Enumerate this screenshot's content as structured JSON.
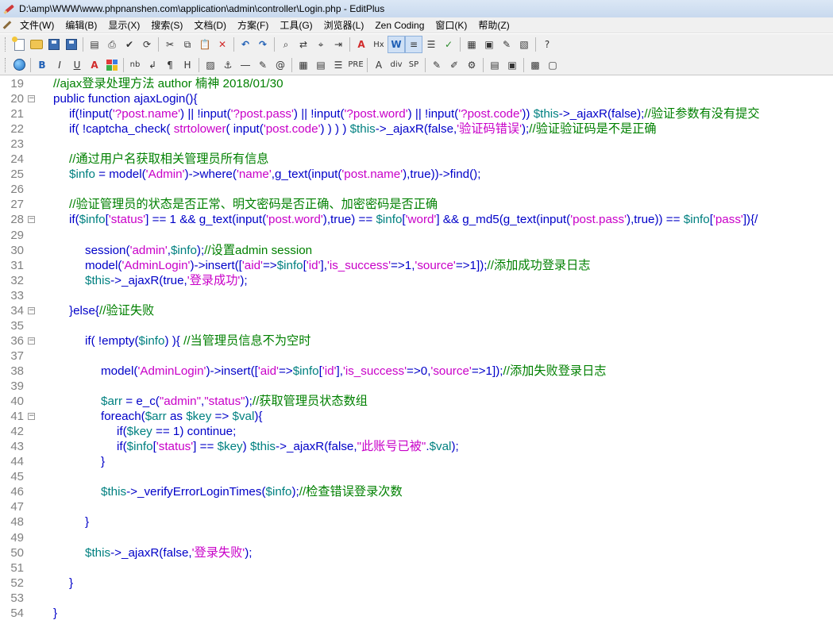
{
  "window": {
    "title": "D:\\amp\\WWW\\www.phpnanshen.com\\application\\admin\\controller\\Login.php - EditPlus"
  },
  "menu": [
    "文件(W)",
    "编辑(B)",
    "显示(X)",
    "搜索(S)",
    "文档(D)",
    "方案(F)",
    "工具(G)",
    "浏览器(L)",
    "Zen Coding",
    "窗口(K)",
    "帮助(Z)"
  ],
  "toolbar1": [
    {
      "name": "new-file-icon",
      "glyph": ""
    },
    {
      "name": "open-folder-icon",
      "glyph": ""
    },
    {
      "name": "save-icon",
      "glyph": ""
    },
    {
      "name": "save-all-icon",
      "glyph": ""
    },
    {
      "name": "print-preview-icon",
      "glyph": "▤"
    },
    {
      "name": "print-icon",
      "glyph": "⎙"
    },
    {
      "name": "spell-check-icon",
      "glyph": "✔"
    },
    {
      "name": "browser-view-icon",
      "glyph": "⟳"
    },
    {
      "name": "cut-icon",
      "glyph": "✂"
    },
    {
      "name": "copy-icon",
      "glyph": "⧉"
    },
    {
      "name": "paste-icon",
      "glyph": "📋"
    },
    {
      "name": "delete-icon",
      "glyph": "✕"
    },
    {
      "name": "undo-icon",
      "glyph": "↶"
    },
    {
      "name": "redo-icon",
      "glyph": "↷"
    },
    {
      "name": "find-icon",
      "glyph": "⌕"
    },
    {
      "name": "replace-icon",
      "glyph": "⇄"
    },
    {
      "name": "find-in-files-icon",
      "glyph": "⌖"
    },
    {
      "name": "go-to-line-icon",
      "glyph": "⇥"
    },
    {
      "name": "font-icon",
      "glyph": "A"
    },
    {
      "name": "hex-icon",
      "glyph": "Hx"
    },
    {
      "name": "word-wrap-icon",
      "glyph": "W"
    },
    {
      "name": "line-number-icon",
      "glyph": "≡"
    },
    {
      "name": "ruler-icon",
      "glyph": "☰"
    },
    {
      "name": "spell-check-toggle-icon",
      "glyph": "✓"
    },
    {
      "name": "output-window-icon",
      "glyph": "▦"
    },
    {
      "name": "clip-text-icon",
      "glyph": "▣"
    },
    {
      "name": "cliptext-edit-icon",
      "glyph": "✎"
    },
    {
      "name": "directory-window-icon",
      "glyph": "▧"
    },
    {
      "name": "help-pointer-icon",
      "glyph": "?"
    }
  ],
  "toolbar2": [
    {
      "name": "browser-icon",
      "glyph": ""
    },
    {
      "name": "bold-icon",
      "glyph": "B"
    },
    {
      "name": "italic-icon",
      "glyph": "I"
    },
    {
      "name": "underline-icon",
      "glyph": "U"
    },
    {
      "name": "font-color-icon",
      "glyph": "A"
    },
    {
      "name": "color-palette-icon",
      "glyph": ""
    },
    {
      "name": "nobr-icon",
      "glyph": "nb"
    },
    {
      "name": "line-break-icon",
      "glyph": "↲"
    },
    {
      "name": "paragraph-icon",
      "glyph": "¶"
    },
    {
      "name": "heading-icon",
      "glyph": "H"
    },
    {
      "name": "image-icon",
      "glyph": "▨"
    },
    {
      "name": "anchor-icon",
      "glyph": "⚓"
    },
    {
      "name": "horizontal-rule-icon",
      "glyph": "―"
    },
    {
      "name": "pencil-icon",
      "glyph": "✎"
    },
    {
      "name": "comment-icon",
      "glyph": "@"
    },
    {
      "name": "table-icon",
      "glyph": "▦"
    },
    {
      "name": "form-icon",
      "glyph": "▤"
    },
    {
      "name": "center-icon",
      "glyph": "☰"
    },
    {
      "name": "pre-icon",
      "glyph": "PRE"
    },
    {
      "name": "char-icon",
      "glyph": "A"
    },
    {
      "name": "div-icon",
      "glyph": "div"
    },
    {
      "name": "span-icon",
      "glyph": "SP"
    },
    {
      "name": "edit-html-icon",
      "glyph": "✎"
    },
    {
      "name": "highlight-icon",
      "glyph": "✐"
    },
    {
      "name": "scripts-icon",
      "glyph": "⚙"
    },
    {
      "name": "html-toolbar-icon",
      "glyph": "▤"
    },
    {
      "name": "html-toolbar2-icon",
      "glyph": "▣"
    },
    {
      "name": "color-picker-icon",
      "glyph": "▩"
    },
    {
      "name": "window-icon",
      "glyph": "▢"
    }
  ],
  "editor": {
    "lines": [
      {
        "n": "19",
        "fold": false,
        "indent": 0,
        "tokens": [
          [
            "cm",
            "//ajax登录处理方法 author 楠神 2018/01/30"
          ]
        ]
      },
      {
        "n": "20",
        "fold": true,
        "indent": 0,
        "tokens": [
          [
            "kw",
            "public function ajaxLogin(){"
          ]
        ]
      },
      {
        "n": "21",
        "fold": false,
        "indent": 1,
        "tokens": [
          [
            "kw",
            "if(!input("
          ],
          [
            "st",
            "'?post.name'"
          ],
          [
            "kw",
            ") || !input("
          ],
          [
            "st",
            "'?post.pass'"
          ],
          [
            "kw",
            ") || !input("
          ],
          [
            "st",
            "'?post.word'"
          ],
          [
            "kw",
            ") || !input("
          ],
          [
            "st",
            "'?post.code'"
          ],
          [
            "kw",
            ")) "
          ],
          [
            "vr",
            "$this"
          ],
          [
            "kw",
            "->_ajaxR(false);"
          ],
          [
            "cm",
            "//验证参数有没有提交"
          ]
        ]
      },
      {
        "n": "22",
        "fold": false,
        "indent": 1,
        "tokens": [
          [
            "kw",
            "if( !captcha_check( "
          ],
          [
            "st",
            "strtolower"
          ],
          [
            "kw",
            "( input("
          ],
          [
            "st",
            "'post.code'"
          ],
          [
            "kw",
            ") ) ) ) "
          ],
          [
            "vr",
            "$this"
          ],
          [
            "kw",
            "->_ajaxR(false,"
          ],
          [
            "st",
            "'验证码错误'"
          ],
          [
            "kw",
            ");"
          ],
          [
            "cm",
            "//验证验证码是不是正确"
          ]
        ]
      },
      {
        "n": "23",
        "fold": false,
        "indent": 0,
        "tokens": []
      },
      {
        "n": "24",
        "fold": false,
        "indent": 1,
        "tokens": [
          [
            "cm",
            "//通过用户名获取相关管理员所有信息"
          ]
        ]
      },
      {
        "n": "25",
        "fold": false,
        "indent": 1,
        "tokens": [
          [
            "vr",
            "$info"
          ],
          [
            "kw",
            " = model("
          ],
          [
            "st",
            "'Admin'"
          ],
          [
            "kw",
            ")->where("
          ],
          [
            "st",
            "'name'"
          ],
          [
            "kw",
            ",g_text(input("
          ],
          [
            "st",
            "'post.name'"
          ],
          [
            "kw",
            "),true))->find();"
          ]
        ]
      },
      {
        "n": "26",
        "fold": false,
        "indent": 0,
        "tokens": []
      },
      {
        "n": "27",
        "fold": false,
        "indent": 1,
        "tokens": [
          [
            "cm",
            "//验证管理员的状态是否正常、明文密码是否正确、加密密码是否正确"
          ]
        ]
      },
      {
        "n": "28",
        "fold": true,
        "indent": 1,
        "tokens": [
          [
            "kw",
            "if("
          ],
          [
            "vr",
            "$info"
          ],
          [
            "kw",
            "["
          ],
          [
            "st",
            "'status'"
          ],
          [
            "kw",
            "] == 1 && g_text(input("
          ],
          [
            "st",
            "'post.word'"
          ],
          [
            "kw",
            "),true) == "
          ],
          [
            "vr",
            "$info"
          ],
          [
            "kw",
            "["
          ],
          [
            "st",
            "'word'"
          ],
          [
            "kw",
            "] && g_md5(g_text(input("
          ],
          [
            "st",
            "'post.pass'"
          ],
          [
            "kw",
            "),true)) == "
          ],
          [
            "vr",
            "$info"
          ],
          [
            "kw",
            "["
          ],
          [
            "st",
            "'pass'"
          ],
          [
            "kw",
            "]){/"
          ]
        ]
      },
      {
        "n": "29",
        "fold": false,
        "indent": 0,
        "tokens": []
      },
      {
        "n": "30",
        "fold": false,
        "indent": 2,
        "tokens": [
          [
            "kw",
            "session("
          ],
          [
            "st",
            "'admin'"
          ],
          [
            "kw",
            ","
          ],
          [
            "vr",
            "$info"
          ],
          [
            "kw",
            ");"
          ],
          [
            "cm",
            "//设置admin session"
          ]
        ]
      },
      {
        "n": "31",
        "fold": false,
        "indent": 2,
        "tokens": [
          [
            "kw",
            "model("
          ],
          [
            "st",
            "'AdminLogin'"
          ],
          [
            "kw",
            ")->insert(["
          ],
          [
            "st",
            "'aid'"
          ],
          [
            "kw",
            "=>"
          ],
          [
            "vr",
            "$info"
          ],
          [
            "kw",
            "["
          ],
          [
            "st",
            "'id'"
          ],
          [
            "kw",
            "],"
          ],
          [
            "st",
            "'is_success'"
          ],
          [
            "kw",
            "=>1,"
          ],
          [
            "st",
            "'source'"
          ],
          [
            "kw",
            "=>1]);"
          ],
          [
            "cm",
            "//添加成功登录日志"
          ]
        ]
      },
      {
        "n": "32",
        "fold": false,
        "indent": 2,
        "tokens": [
          [
            "vr",
            "$this"
          ],
          [
            "kw",
            "->_ajaxR(true,"
          ],
          [
            "st",
            "'登录成功'"
          ],
          [
            "kw",
            ");"
          ]
        ]
      },
      {
        "n": "33",
        "fold": false,
        "indent": 0,
        "tokens": []
      },
      {
        "n": "34",
        "fold": true,
        "indent": 1,
        "tokens": [
          [
            "kw",
            "}else{"
          ],
          [
            "cm",
            "//验证失败"
          ]
        ]
      },
      {
        "n": "35",
        "fold": false,
        "indent": 0,
        "tokens": []
      },
      {
        "n": "36",
        "fold": true,
        "indent": 2,
        "tokens": [
          [
            "kw",
            "if( !empty("
          ],
          [
            "vr",
            "$info"
          ],
          [
            "kw",
            ") ){ "
          ],
          [
            "cm",
            "//当管理员信息不为空时"
          ]
        ]
      },
      {
        "n": "37",
        "fold": false,
        "indent": 0,
        "tokens": []
      },
      {
        "n": "38",
        "fold": false,
        "indent": 3,
        "tokens": [
          [
            "kw",
            "model("
          ],
          [
            "st",
            "'AdminLogin'"
          ],
          [
            "kw",
            ")->insert(["
          ],
          [
            "st",
            "'aid'"
          ],
          [
            "kw",
            "=>"
          ],
          [
            "vr",
            "$info"
          ],
          [
            "kw",
            "["
          ],
          [
            "st",
            "'id'"
          ],
          [
            "kw",
            "],"
          ],
          [
            "st",
            "'is_success'"
          ],
          [
            "kw",
            "=>0,"
          ],
          [
            "st",
            "'source'"
          ],
          [
            "kw",
            "=>1]);"
          ],
          [
            "cm",
            "//添加失败登录日志"
          ]
        ]
      },
      {
        "n": "39",
        "fold": false,
        "indent": 0,
        "tokens": []
      },
      {
        "n": "40",
        "fold": false,
        "indent": 3,
        "tokens": [
          [
            "vr",
            "$arr"
          ],
          [
            "kw",
            " = e_c("
          ],
          [
            "st",
            "\"admin\""
          ],
          [
            "kw",
            ","
          ],
          [
            "st",
            "\"status\""
          ],
          [
            "kw",
            ");"
          ],
          [
            "cm",
            "//获取管理员状态数组"
          ]
        ]
      },
      {
        "n": "41",
        "fold": true,
        "indent": 3,
        "tokens": [
          [
            "kw",
            "foreach("
          ],
          [
            "vr",
            "$arr"
          ],
          [
            "kw",
            " as "
          ],
          [
            "vr",
            "$key"
          ],
          [
            "kw",
            " => "
          ],
          [
            "vr",
            "$val"
          ],
          [
            "kw",
            "){"
          ]
        ]
      },
      {
        "n": "42",
        "fold": false,
        "indent": 4,
        "tokens": [
          [
            "kw",
            "if("
          ],
          [
            "vr",
            "$key"
          ],
          [
            "kw",
            " == 1) continue;"
          ]
        ]
      },
      {
        "n": "43",
        "fold": false,
        "indent": 4,
        "tokens": [
          [
            "kw",
            "if("
          ],
          [
            "vr",
            "$info"
          ],
          [
            "kw",
            "["
          ],
          [
            "st",
            "'status'"
          ],
          [
            "kw",
            "] == "
          ],
          [
            "vr",
            "$key"
          ],
          [
            "kw",
            ") "
          ],
          [
            "vr",
            "$this"
          ],
          [
            "kw",
            "->_ajaxR(false,"
          ],
          [
            "st",
            "\"此账号已被\""
          ],
          [
            "kw",
            "."
          ],
          [
            "vr",
            "$val"
          ],
          [
            "kw",
            ");"
          ]
        ]
      },
      {
        "n": "44",
        "fold": false,
        "indent": 3,
        "tokens": [
          [
            "kw",
            "}"
          ]
        ]
      },
      {
        "n": "45",
        "fold": false,
        "indent": 0,
        "tokens": []
      },
      {
        "n": "46",
        "fold": false,
        "indent": 3,
        "tokens": [
          [
            "vr",
            "$this"
          ],
          [
            "kw",
            "->_verifyErrorLoginTimes("
          ],
          [
            "vr",
            "$info"
          ],
          [
            "kw",
            ");"
          ],
          [
            "cm",
            "//检查错误登录次数"
          ]
        ]
      },
      {
        "n": "47",
        "fold": false,
        "indent": 0,
        "tokens": []
      },
      {
        "n": "48",
        "fold": false,
        "indent": 2,
        "tokens": [
          [
            "kw",
            "}"
          ]
        ]
      },
      {
        "n": "49",
        "fold": false,
        "indent": 0,
        "tokens": []
      },
      {
        "n": "50",
        "fold": false,
        "indent": 2,
        "tokens": [
          [
            "vr",
            "$this"
          ],
          [
            "kw",
            "->_ajaxR(false,"
          ],
          [
            "st",
            "'登录失败'"
          ],
          [
            "kw",
            ");"
          ]
        ]
      },
      {
        "n": "51",
        "fold": false,
        "indent": 0,
        "tokens": []
      },
      {
        "n": "52",
        "fold": false,
        "indent": 1,
        "tokens": [
          [
            "kw",
            "}"
          ]
        ]
      },
      {
        "n": "53",
        "fold": false,
        "indent": 0,
        "tokens": []
      },
      {
        "n": "54",
        "fold": false,
        "indent": 0,
        "tokens": [
          [
            "kw",
            "}"
          ]
        ]
      }
    ]
  }
}
